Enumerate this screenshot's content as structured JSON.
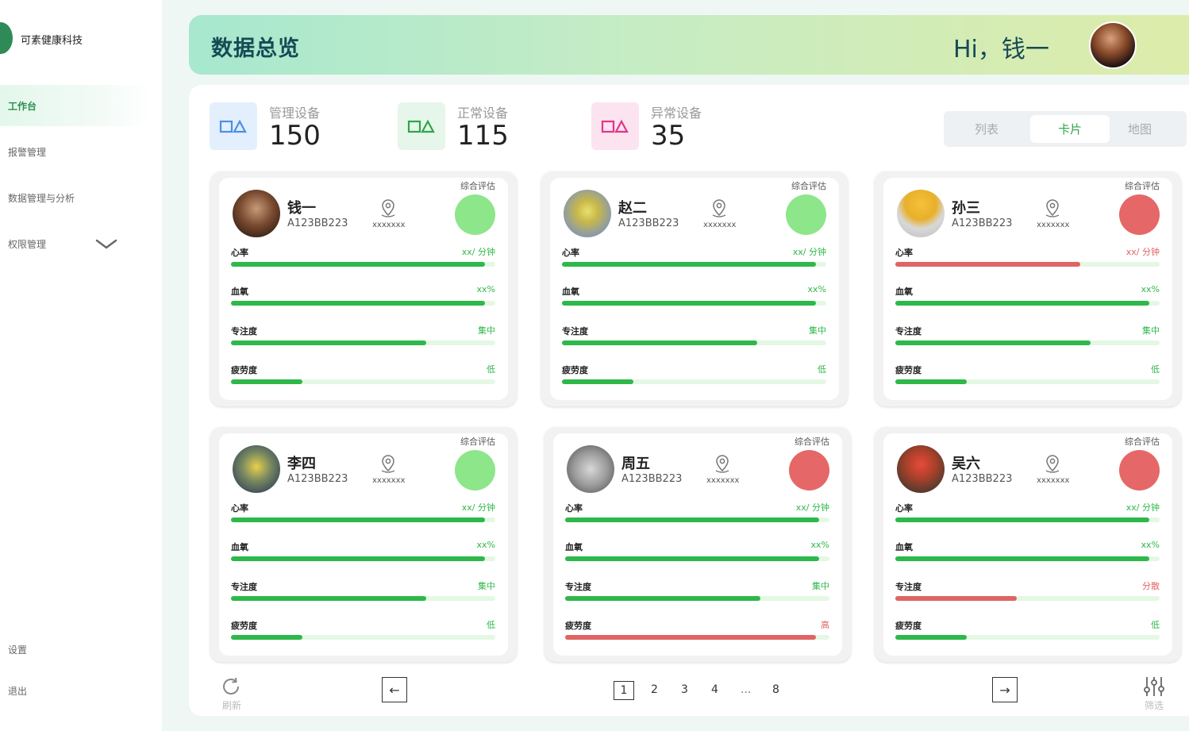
{
  "app": {
    "name": "可素健康科技"
  },
  "sidebar": {
    "items": [
      {
        "label": "工作台",
        "active": true
      },
      {
        "label": "报警管理"
      },
      {
        "label": "数据管理与分析"
      },
      {
        "label": "权限管理",
        "icon": "chevron-down-icon"
      }
    ],
    "bottom": [
      {
        "label": "设置"
      },
      {
        "label": "退出"
      }
    ]
  },
  "header": {
    "title": "数据总览",
    "greeting": "Hi，钱一",
    "avatar_icon": "user-avatar"
  },
  "stats": [
    {
      "label": "管理设备",
      "value": "150",
      "color": "#4a8fe7"
    },
    {
      "label": "正常设备",
      "value": "115",
      "color": "#2fa548"
    },
    {
      "label": "异常设备",
      "value": "35",
      "color": "#e0368d"
    }
  ],
  "view_toggle": {
    "options": [
      "列表",
      "卡片",
      "地图"
    ],
    "selected": "卡片"
  },
  "colors": {
    "green": "#2eb84a",
    "red": "#e06464",
    "status_good": "#8de68a",
    "status_bad": "#e56767"
  },
  "cards": [
    {
      "name": "钱一",
      "id": "A123BB223",
      "location": "xxxxxxx",
      "eval_label": "综合评估",
      "status": "good",
      "metrics": [
        {
          "label": "心率",
          "value": "xx/ 分钟",
          "level": 0.96,
          "state": "good"
        },
        {
          "label": "血氧",
          "value": "xx%",
          "level": 0.96,
          "state": "good"
        },
        {
          "label": "专注度",
          "value": "集中",
          "level": 0.74,
          "state": "good"
        },
        {
          "label": "疲劳度",
          "value": "低",
          "level": 0.27,
          "state": "good"
        }
      ]
    },
    {
      "name": "赵二",
      "id": "A123BB223",
      "location": "xxxxxxx",
      "eval_label": "综合评估",
      "status": "good",
      "metrics": [
        {
          "label": "心率",
          "value": "xx/ 分钟",
          "level": 0.96,
          "state": "good"
        },
        {
          "label": "血氧",
          "value": "xx%",
          "level": 0.96,
          "state": "good"
        },
        {
          "label": "专注度",
          "value": "集中",
          "level": 0.74,
          "state": "good"
        },
        {
          "label": "疲劳度",
          "value": "低",
          "level": 0.27,
          "state": "good"
        }
      ]
    },
    {
      "name": "孙三",
      "id": "A123BB223",
      "location": "xxxxxxx",
      "eval_label": "综合评估",
      "status": "bad",
      "metrics": [
        {
          "label": "心率",
          "value": "xx/ 分钟",
          "level": 0.7,
          "state": "bad"
        },
        {
          "label": "血氧",
          "value": "xx%",
          "level": 0.96,
          "state": "good"
        },
        {
          "label": "专注度",
          "value": "集中",
          "level": 0.74,
          "state": "good"
        },
        {
          "label": "疲劳度",
          "value": "低",
          "level": 0.27,
          "state": "good"
        }
      ]
    },
    {
      "name": "李四",
      "id": "A123BB223",
      "location": "xxxxxxx",
      "eval_label": "综合评估",
      "status": "good",
      "metrics": [
        {
          "label": "心率",
          "value": "xx/ 分钟",
          "level": 0.96,
          "state": "good"
        },
        {
          "label": "血氧",
          "value": "xx%",
          "level": 0.96,
          "state": "good"
        },
        {
          "label": "专注度",
          "value": "集中",
          "level": 0.74,
          "state": "good"
        },
        {
          "label": "疲劳度",
          "value": "低",
          "level": 0.27,
          "state": "good"
        }
      ]
    },
    {
      "name": "周五",
      "id": "A123BB223",
      "location": "xxxxxxx",
      "eval_label": "综合评估",
      "status": "bad",
      "metrics": [
        {
          "label": "心率",
          "value": "xx/ 分钟",
          "level": 0.96,
          "state": "good"
        },
        {
          "label": "血氧",
          "value": "xx%",
          "level": 0.96,
          "state": "good"
        },
        {
          "label": "专注度",
          "value": "集中",
          "level": 0.74,
          "state": "good"
        },
        {
          "label": "疲劳度",
          "value": "高",
          "level": 0.95,
          "state": "bad"
        }
      ]
    },
    {
      "name": "吴六",
      "id": "A123BB223",
      "location": "xxxxxxx",
      "eval_label": "综合评估",
      "status": "bad",
      "metrics": [
        {
          "label": "心率",
          "value": "xx/ 分钟",
          "level": 0.96,
          "state": "good"
        },
        {
          "label": "血氧",
          "value": "xx%",
          "level": 0.96,
          "state": "good"
        },
        {
          "label": "专注度",
          "value": "分散",
          "level": 0.46,
          "state": "bad"
        },
        {
          "label": "疲劳度",
          "value": "低",
          "level": 0.27,
          "state": "good"
        }
      ]
    }
  ],
  "footer": {
    "refresh_label": "刷新",
    "prev_icon": "arrow-left-icon",
    "next_icon": "arrow-right-icon",
    "pages": [
      "1",
      "2",
      "3",
      "4",
      "...",
      "8"
    ],
    "current_page": "1",
    "filter_label": "筛选"
  }
}
